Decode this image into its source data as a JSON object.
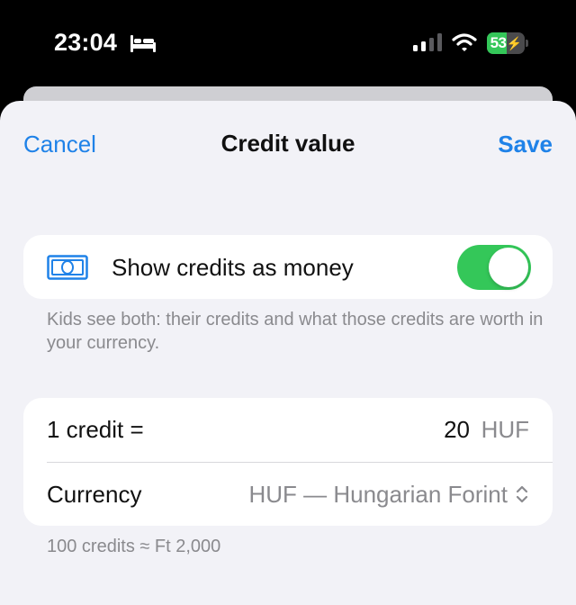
{
  "status_bar": {
    "time": "23:04",
    "battery_level": "53",
    "battery_fraction": 0.53,
    "icons": [
      "bed-icon",
      "cellular-signal-icon",
      "wifi-icon",
      "battery-icon"
    ]
  },
  "nav": {
    "cancel_label": "Cancel",
    "title": "Credit value",
    "save_label": "Save"
  },
  "toggle_section": {
    "icon": "money-icon",
    "label": "Show credits as money",
    "enabled": true,
    "footnote": "Kids see both: their credits and what those credits are worth in your currency."
  },
  "value_section": {
    "credit_label": "1 credit =",
    "amount": "20",
    "unit": "HUF",
    "currency_label": "Currency",
    "currency_value": "HUF — Hungarian Forint",
    "currency_icon": "chevron-up-down-icon",
    "footnote": "100 credits ≈ Ft 2,000"
  },
  "colors": {
    "accent": "#1f82e8",
    "switch_on": "#34c759",
    "sheet_background": "#f2f2f7",
    "secondary_text": "#8a8a8e"
  }
}
